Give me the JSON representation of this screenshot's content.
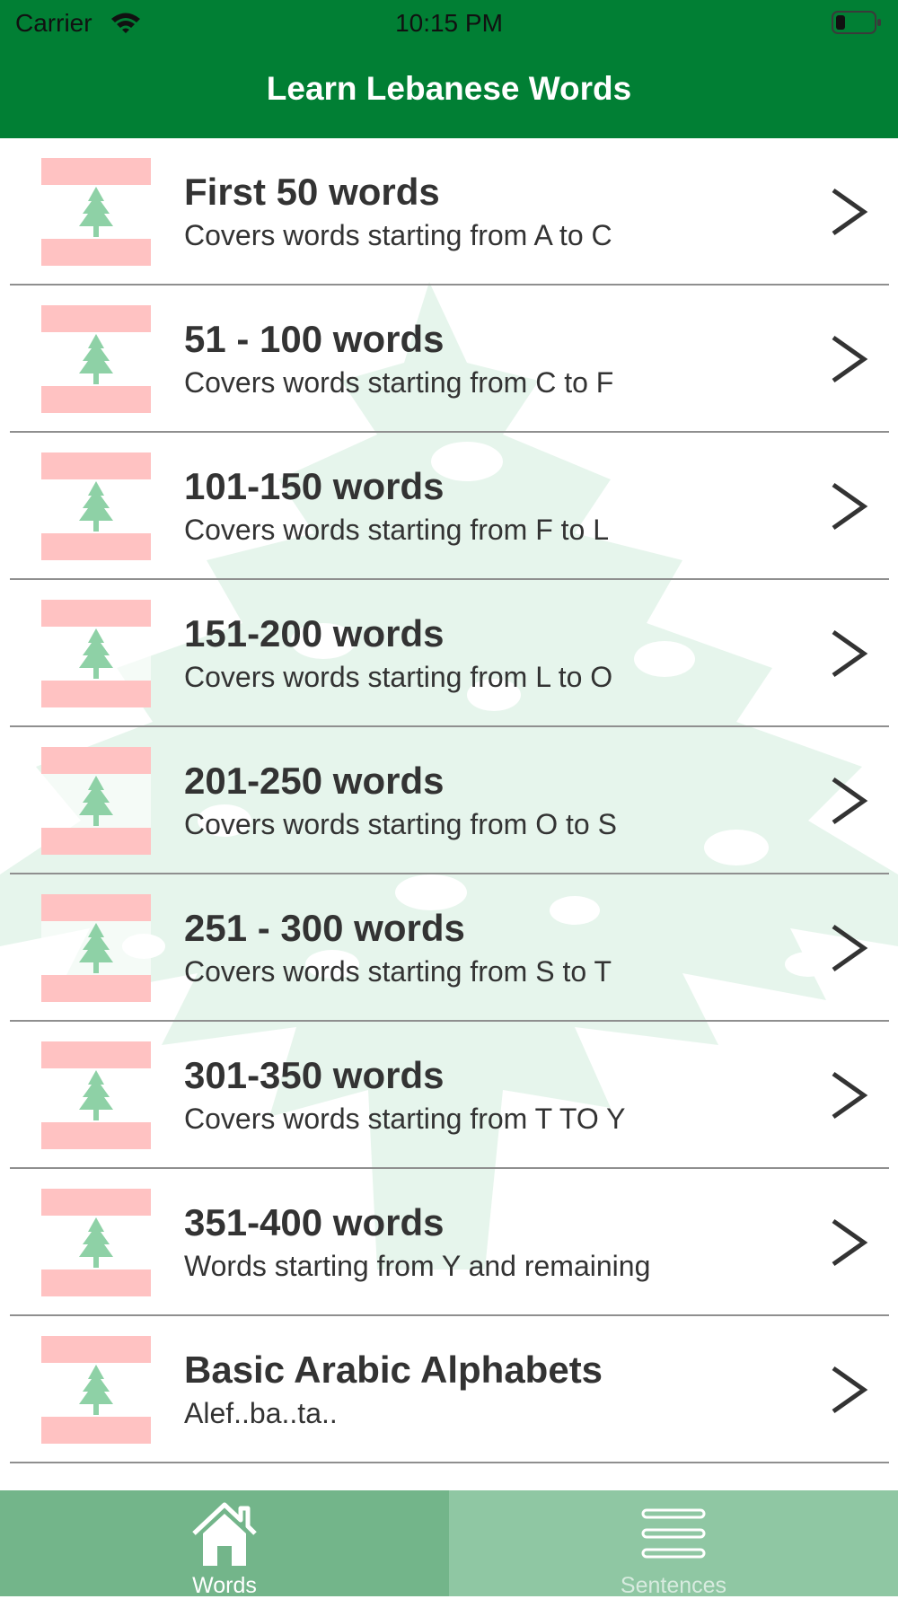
{
  "status_bar": {
    "carrier": "Carrier",
    "time": "10:15 PM"
  },
  "nav": {
    "title": "Learn Lebanese Words",
    "color": "#017f34"
  },
  "rows": [
    {
      "title": "First 50 words",
      "subtitle": "Covers words starting from A to C"
    },
    {
      "title": "51 - 100 words",
      "subtitle": "Covers words starting from C to F"
    },
    {
      "title": "101-150 words",
      "subtitle": "Covers words starting from F to L"
    },
    {
      "title": "151-200 words",
      "subtitle": "Covers words starting from L to O"
    },
    {
      "title": "201-250 words",
      "subtitle": "Covers words starting from O to S"
    },
    {
      "title": "251 - 300 words",
      "subtitle": "Covers words starting from S to T"
    },
    {
      "title": "301-350 words",
      "subtitle": "Covers words starting from T TO Y"
    },
    {
      "title": "351-400 words",
      "subtitle": "Words starting from Y and remaining"
    },
    {
      "title": "Basic Arabic Alphabets",
      "subtitle": "Alef..ba..ta.."
    }
  ],
  "row_icon": "lebanon-flag-icon",
  "row_accessory_icon": "chevron-right-icon",
  "tabs": [
    {
      "label": "Words",
      "icon": "home-icon",
      "selected": true
    },
    {
      "label": "Sentences",
      "icon": "menu-lines-icon",
      "selected": false
    }
  ],
  "colors": {
    "flag_red": "#ffc2c2",
    "cedar_green": "#8ed1a6",
    "tab_selected": "#73b58a",
    "tab_unselected": "#8fc7a3"
  }
}
